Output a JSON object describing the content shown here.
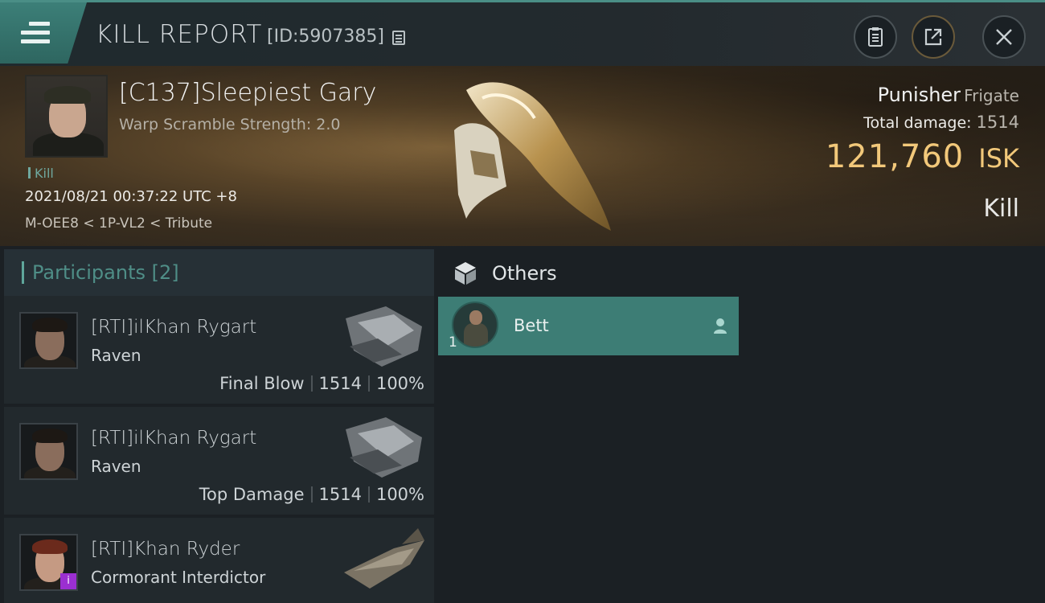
{
  "header": {
    "title": "KILL REPORT",
    "id_label": "[ID:5907385]"
  },
  "victim": {
    "name": "[C137]Sleepiest Gary",
    "subtitle": "Warp Scramble Strength: 2.0",
    "tag": "Kill",
    "timestamp": "2021/08/21 00:37:22 UTC +8",
    "location": "M-OEE8 < 1P-VL2 < Tribute",
    "ship_name": "Punisher",
    "ship_class": "Frigate",
    "total_damage_label": "Total damage:",
    "total_damage": "1514",
    "isk_value": "121,760",
    "isk_currency": "ISK",
    "kill_type": "Kill"
  },
  "participants": {
    "title": "Participants [2]",
    "items": [
      {
        "name": "[RTI]ilKhan Rygart",
        "ship": "Raven",
        "role": "Final Blow",
        "damage": "1514",
        "percent": "100%"
      },
      {
        "name": "[RTI]ilKhan Rygart",
        "ship": "Raven",
        "role": "Top Damage",
        "damage": "1514",
        "percent": "100%"
      },
      {
        "name": "[RTI]Khan Ryder",
        "ship": "Cormorant Interdictor",
        "badge": "i"
      }
    ]
  },
  "others": {
    "title": "Others",
    "items": [
      {
        "name": "Bett",
        "count": "1"
      }
    ]
  },
  "colors": {
    "accent_teal": "#3d7d75",
    "isk_gold": "#f2c87a",
    "participants_title": "#4f8e87"
  }
}
